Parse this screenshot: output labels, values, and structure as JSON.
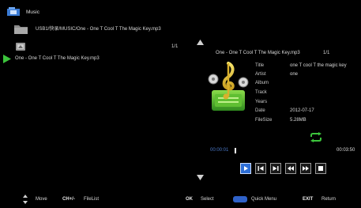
{
  "header": {
    "title": "Music"
  },
  "browser": {
    "path": "USB1/快录/MUSIC/One - One T Cool T The Magic Key.mp3",
    "page": "1/1",
    "files": [
      {
        "name": "One - One T Cool T The Magic Key.mp3"
      }
    ]
  },
  "info": {
    "filename": "One - One T Cool T The Magic Key.mp3",
    "page": "1/1",
    "labels": {
      "title": "Title",
      "artist": "Artist",
      "album": "Album",
      "track": "Track",
      "years": "Years",
      "date": "Date",
      "filesize": "FileSize"
    },
    "values": {
      "title": "one T cool T the magic key",
      "artist": "one",
      "album": "",
      "track": "",
      "years": "",
      "date": "2012-07-17",
      "filesize": "5.28MB"
    }
  },
  "playback": {
    "elapsed": "00:00:01",
    "total": "00:03:50",
    "progress_fraction": 0.004,
    "selected_control": "play"
  },
  "footer": {
    "move_label": "Move",
    "ch_key": "CH+/-",
    "filelist_label": "FileList",
    "ok_key": "OK",
    "select_label": "Select",
    "quickmenu_label": "Quick Menu",
    "exit_key": "EXIT",
    "return_label": "Return"
  },
  "colors": {
    "accent": "#2d6ed6",
    "repeat": "#3cc43c",
    "play_marker": "#3cc43c",
    "elapsed_time": "#4a78c8"
  },
  "icons": {
    "app": "music-app-icon",
    "folder": "folder-icon",
    "up": "up-folder-icon",
    "playing": "play-marker-icon",
    "art": "music-note-icon",
    "repeat": "repeat-icon"
  }
}
